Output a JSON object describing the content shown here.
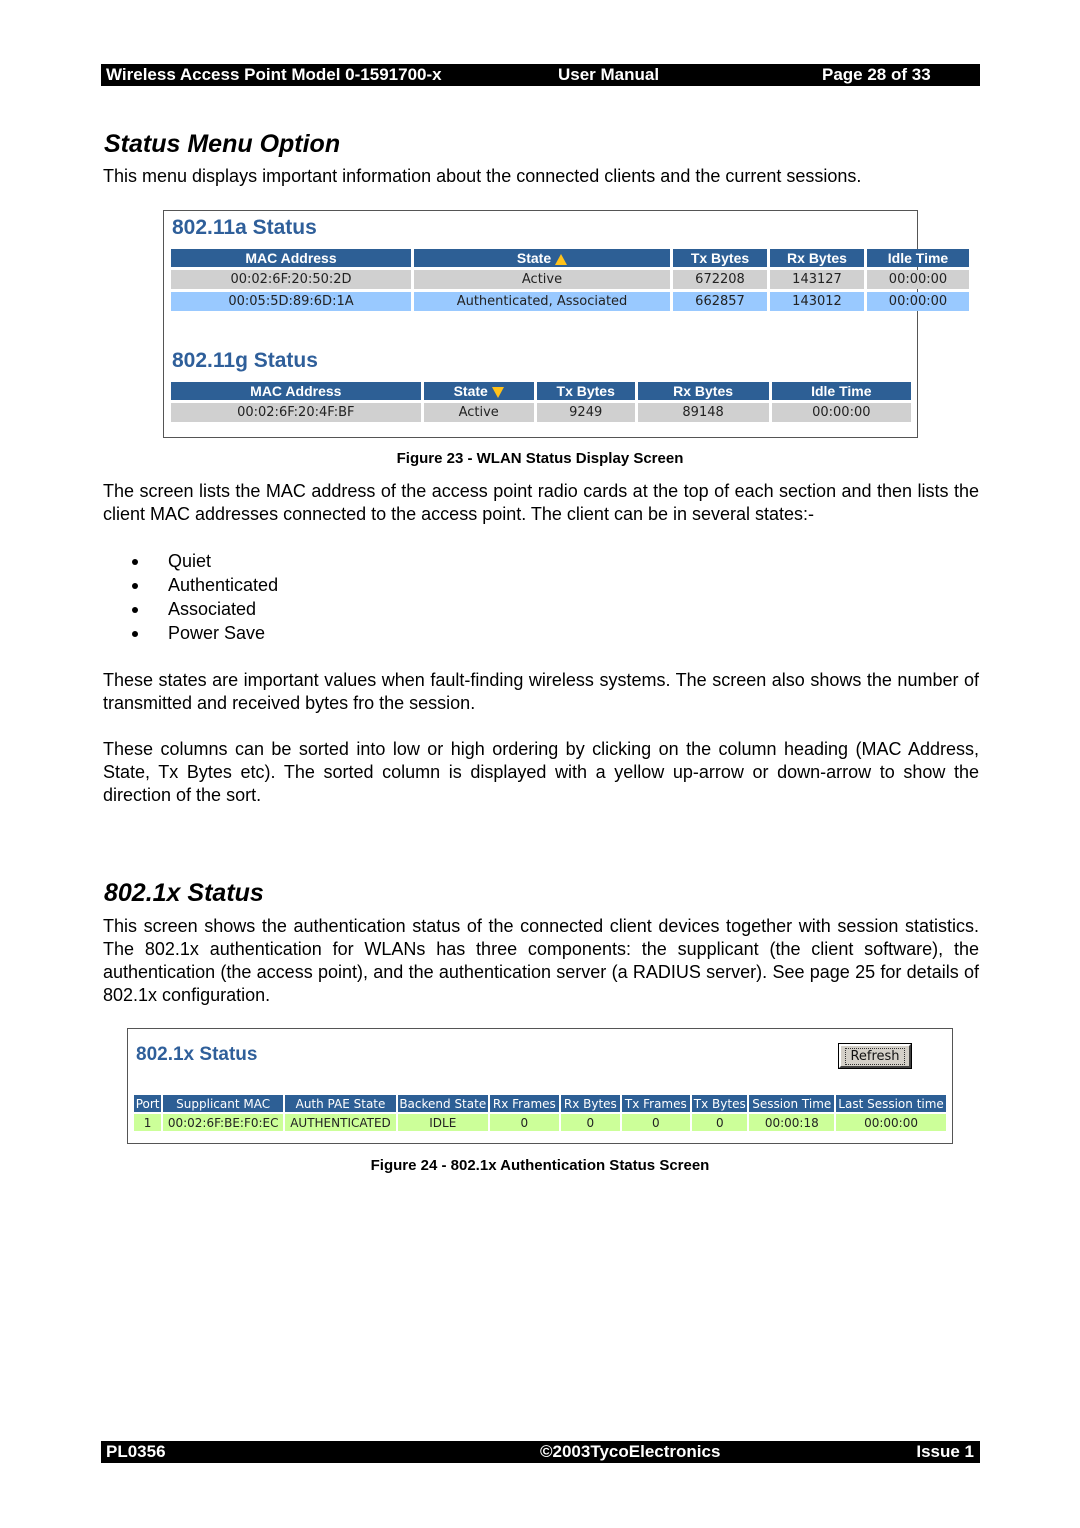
{
  "header": {
    "product": "Wireless Access Point  Model 0-1591700-x",
    "doc_type": "User Manual",
    "page": "Page 28 of 33"
  },
  "section1": {
    "title": "Status Menu Option",
    "intro": "This menu displays important information about the connected clients and the current sessions."
  },
  "figure23": {
    "wlan_a": {
      "title": "802.11a Status",
      "columns": [
        "MAC Address",
        "State",
        "Tx Bytes",
        "Rx Bytes",
        "Idle Time"
      ],
      "sort_column": "State",
      "sort_direction": "up",
      "rows": [
        [
          "00:02:6F:20:50:2D",
          "Active",
          "672208",
          "143127",
          "00:00:00"
        ],
        [
          "00:05:5D:89:6D:1A",
          "Authenticated, Associated",
          "662857",
          "143012",
          "00:00:00"
        ]
      ]
    },
    "wlan_g": {
      "title": "802.11g Status",
      "columns": [
        "MAC Address",
        "State",
        "Tx Bytes",
        "Rx Bytes",
        "Idle Time"
      ],
      "sort_column": "State",
      "sort_direction": "down",
      "rows": [
        [
          "00:02:6F:20:4F:BF",
          "Active",
          "9249",
          "89148",
          "00:00:00"
        ]
      ]
    },
    "caption": "Figure 23 - WLAN Status Display Screen"
  },
  "body1": {
    "para1": "The screen lists the MAC address of the access point radio cards at the top of each section and then lists the client MAC addresses connected to the access point. The client can be in several states:-",
    "states": [
      "Quiet",
      "Authenticated",
      "Associated",
      "Power Save"
    ],
    "para2": "These states are important values when fault-finding wireless systems. The screen also shows the number of transmitted and received bytes fro the session.",
    "para3": "These columns can be sorted into low or high ordering by clicking on the column heading (MAC Address, State, Tx Bytes etc). The sorted column is displayed with a yellow up-arrow or down-arrow to show the direction of the sort."
  },
  "section2": {
    "title": "802.1x Status",
    "para": "This screen shows the authentication status of the connected client devices together with session statistics. The 802.1x authentication for WLANs has three components: the supplicant (the client software), the authentication (the access point), and the authentication server (a RADIUS server). See page 25 for details of 802.1x configuration."
  },
  "figure24": {
    "title": "802.1x Status",
    "refresh_label": "Refresh",
    "columns": [
      "Port",
      "Supplicant MAC",
      "Auth PAE State",
      "Backend State",
      "Rx Frames",
      "Rx Bytes",
      "Tx Frames",
      "Tx Bytes",
      "Session Time",
      "Last Session time"
    ],
    "rows": [
      [
        "1",
        "00:02:6F:BE:F0:EC",
        "AUTHENTICATED",
        "IDLE",
        "0",
        "0",
        "0",
        "0",
        "00:00:18",
        "00:00:00"
      ]
    ],
    "caption": "Figure 24 - 802.1x Authentication Status Screen"
  },
  "footer": {
    "doc_id": "PL0356",
    "copyright": "©2003TycoElectronics",
    "issue": "Issue 1"
  },
  "colors": {
    "table_header": "#2d5f95",
    "ui_title": "#2f5f9a",
    "row_grey": "#d0d0d0",
    "row_blue": "#99c9ff",
    "row_green": "#ccff99",
    "sort_arrow": "#ffc21a"
  }
}
